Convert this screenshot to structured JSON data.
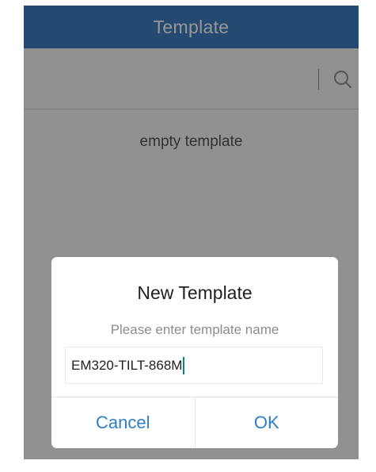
{
  "header": {
    "title": "Template"
  },
  "search": {
    "icon": "search-icon"
  },
  "content": {
    "empty_text": "empty template"
  },
  "dialog": {
    "title": "New Template",
    "hint": "Please enter template name",
    "input_value": "EM320-TILT-868M",
    "cancel_label": "Cancel",
    "ok_label": "OK"
  },
  "colors": {
    "header_bg": "#3b78b8",
    "accent": "#2e7fc4",
    "caret": "#00897b"
  }
}
